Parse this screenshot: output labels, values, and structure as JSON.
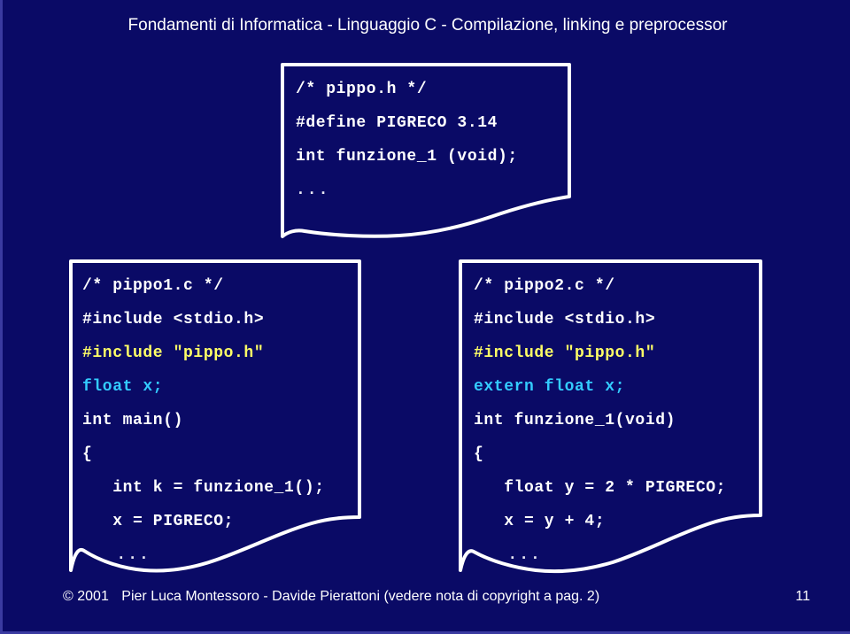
{
  "slide": {
    "title": "Fondamenti di Informatica - Linguaggio C - Compilazione, linking e preprocessor",
    "background_color": "#0a0a66",
    "border_color": "#3a3aa0",
    "page_number": "11"
  },
  "colors": {
    "text_white": "#ffffff",
    "text_yellow": "#ffff66",
    "text_cyan": "#33ccff",
    "card_border": "#ffffff"
  },
  "cards": {
    "header_file": {
      "name": "pippo.h",
      "lines": [
        {
          "text": "/* pippo.h */",
          "color": "white"
        },
        {
          "text": "#define PIGRECO 3.14",
          "color": "white"
        },
        {
          "text": "int funzione_1 (void);",
          "color": "white"
        },
        {
          "text": "...",
          "color": "dots"
        }
      ]
    },
    "source_one": {
      "name": "pippo1.c",
      "lines": [
        {
          "text": "/* pippo1.c */",
          "color": "white"
        },
        {
          "text": "#include <stdio.h>",
          "color": "white"
        },
        {
          "text": "#include \"pippo.h\"",
          "color": "yellow"
        },
        {
          "text": "float x;",
          "color": "cyan"
        },
        {
          "text": "int main()",
          "color": "white"
        },
        {
          "text": "{",
          "color": "white"
        },
        {
          "text": "   int k = funzione_1();",
          "color": "white"
        },
        {
          "text": "   x = PIGRECO;",
          "color": "white"
        },
        {
          "text": "   ...",
          "color": "dots"
        }
      ]
    },
    "source_two": {
      "name": "pippo2.c",
      "lines": [
        {
          "text": "/* pippo2.c */",
          "color": "white"
        },
        {
          "text": "#include <stdio.h>",
          "color": "white"
        },
        {
          "text": "#include \"pippo.h\"",
          "color": "yellow"
        },
        {
          "text": "extern float x;",
          "color": "cyan"
        },
        {
          "text": "int funzione_1(void)",
          "color": "white"
        },
        {
          "text": "{",
          "color": "white"
        },
        {
          "text": "   float y = 2 * PIGRECO;",
          "color": "white"
        },
        {
          "text": "   x = y + 4;",
          "color": "white"
        },
        {
          "text": "   ...",
          "color": "dots"
        }
      ]
    }
  },
  "footer": {
    "copyright_symbol": "©",
    "year": "2001",
    "authors": "Pier Luca Montessoro - Davide Pierattoni (vedere nota di copyright a pag. 2)",
    "page": "11"
  }
}
